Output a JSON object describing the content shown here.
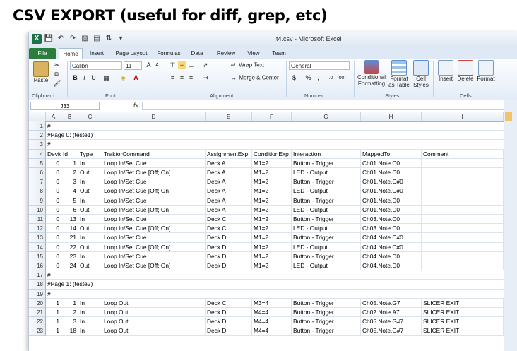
{
  "slide": {
    "title": "CSV EXPORT (useful for diff, grep, etc)"
  },
  "window": {
    "title": "t4.csv  -  Microsoft Excel"
  },
  "tabs": [
    "File",
    "Home",
    "Insert",
    "Page Layout",
    "Formulas",
    "Data",
    "Review",
    "View",
    "Team"
  ],
  "ribbon": {
    "paste": "Paste",
    "font_name": "Calibri",
    "font_size": "11",
    "bold": "B",
    "italic": "I",
    "underline": "U",
    "wrap_text": "Wrap Text",
    "merge_center": "Merge & Center",
    "number_format": "General",
    "percent": "%",
    "comma": ",",
    "conditional_formatting": "Conditional Formatting",
    "format_as_table": "Format as Table",
    "cell_styles": "Cell Styles",
    "insert": "Insert",
    "delete": "Delete",
    "format": "Format",
    "groups": {
      "clipboard": "Clipboard",
      "font": "Font",
      "alignment": "Alignment",
      "number": "Number",
      "styles": "Styles",
      "cells": "Cells"
    }
  },
  "formula_bar": {
    "name_box": "J33",
    "fx": "fx",
    "value": ""
  },
  "columns": [
    "A",
    "B",
    "C",
    "D",
    "E",
    "F",
    "G",
    "H",
    "I"
  ],
  "rows": [
    {
      "n": "1",
      "c": [
        "#",
        "",
        "",
        "",
        "",
        "",
        "",
        "",
        ""
      ]
    },
    {
      "n": "2",
      "c": [
        "#Page 0: (teste1)",
        "",
        "",
        "",
        "",
        "",
        "",
        "",
        ""
      ]
    },
    {
      "n": "3",
      "c": [
        "#",
        "",
        "",
        "",
        "",
        "",
        "",
        "",
        ""
      ]
    },
    {
      "n": "4",
      "c": [
        "Device",
        "Id",
        "Type",
        "TraktorCommand",
        "AssignmentExp",
        "ConditionExp",
        "Interaction",
        "MappedTo",
        "Comment"
      ]
    },
    {
      "n": "5",
      "c": [
        "0",
        "1",
        "In",
        "Loop In/Set Cue",
        "Deck A",
        "M1=2",
        "Button - Trigger",
        "Ch01.Note.C0",
        ""
      ]
    },
    {
      "n": "6",
      "c": [
        "0",
        "2",
        "Out",
        "Loop In/Set Cue [Off; On]",
        "Deck A",
        "M1=2",
        "LED - Output",
        "Ch01.Note.C0",
        ""
      ]
    },
    {
      "n": "7",
      "c": [
        "0",
        "3",
        "In",
        "Loop In/Set Cue",
        "Deck A",
        "M1=2",
        "Button - Trigger",
        "Ch01.Note.C#0",
        ""
      ]
    },
    {
      "n": "8",
      "c": [
        "0",
        "4",
        "Out",
        "Loop In/Set Cue [Off; On]",
        "Deck A",
        "M1=2",
        "LED - Output",
        "Ch01.Note.C#0",
        ""
      ]
    },
    {
      "n": "9",
      "c": [
        "0",
        "5",
        "In",
        "Loop In/Set Cue",
        "Deck A",
        "M1=2",
        "Button - Trigger",
        "Ch01.Note.D0",
        ""
      ]
    },
    {
      "n": "10",
      "c": [
        "0",
        "6",
        "Out",
        "Loop In/Set Cue [Off; On]",
        "Deck A",
        "M1=2",
        "LED - Output",
        "Ch01.Note.D0",
        ""
      ]
    },
    {
      "n": "11",
      "c": [
        "0",
        "13",
        "In",
        "Loop In/Set Cue",
        "Deck C",
        "M1=2",
        "Button - Trigger",
        "Ch03.Note.C0",
        ""
      ]
    },
    {
      "n": "12",
      "c": [
        "0",
        "14",
        "Out",
        "Loop In/Set Cue [Off; On]",
        "Deck C",
        "M1=2",
        "LED - Output",
        "Ch03.Note.C0",
        ""
      ]
    },
    {
      "n": "13",
      "c": [
        "0",
        "21",
        "In",
        "Loop In/Set Cue",
        "Deck D",
        "M1=2",
        "Button - Trigger",
        "Ch04.Note.C#0",
        ""
      ]
    },
    {
      "n": "14",
      "c": [
        "0",
        "22",
        "Out",
        "Loop In/Set Cue [Off; On]",
        "Deck D",
        "M1=2",
        "LED - Output",
        "Ch04.Note.C#0",
        ""
      ]
    },
    {
      "n": "15",
      "c": [
        "0",
        "23",
        "In",
        "Loop In/Set Cue",
        "Deck D",
        "M1=2",
        "Button - Trigger",
        "Ch04.Note.D0",
        ""
      ]
    },
    {
      "n": "16",
      "c": [
        "0",
        "24",
        "Out",
        "Loop In/Set Cue [Off; On]",
        "Deck D",
        "M1=2",
        "LED - Output",
        "Ch04.Note.D0",
        ""
      ]
    },
    {
      "n": "17",
      "c": [
        "#",
        "",
        "",
        "",
        "",
        "",
        "",
        "",
        ""
      ]
    },
    {
      "n": "18",
      "c": [
        "#Page 1: (teste2)",
        "",
        "",
        "",
        "",
        "",
        "",
        "",
        ""
      ]
    },
    {
      "n": "19",
      "c": [
        "#",
        "",
        "",
        "",
        "",
        "",
        "",
        "",
        ""
      ]
    },
    {
      "n": "20",
      "c": [
        "1",
        "1",
        "In",
        "Loop Out",
        "Deck C",
        "M3=4",
        "Button - Trigger",
        "Ch05.Note.G7",
        "SLICER EXIT"
      ]
    },
    {
      "n": "21",
      "c": [
        "1",
        "2",
        "In",
        "Loop Out",
        "Deck D",
        "M4=4",
        "Button - Trigger",
        "Ch02.Note.A7",
        "SLICER EXIT"
      ]
    },
    {
      "n": "22",
      "c": [
        "1",
        "3",
        "In",
        "Loop Out",
        "Deck D",
        "M4=4",
        "Button - Trigger",
        "Ch05.Note.G#7",
        "SLICER EXIT"
      ]
    },
    {
      "n": "23",
      "c": [
        "1",
        "18",
        "In",
        "Loop Out",
        "Deck D",
        "M4=4",
        "Button - Trigger",
        "Ch05.Note.G#7",
        "SLICER EXIT"
      ]
    }
  ],
  "colors": {
    "file_tab": "#2a7d3d",
    "header_bg": "#e4ebf3",
    "ribbon_border": "#a9bfd6"
  }
}
